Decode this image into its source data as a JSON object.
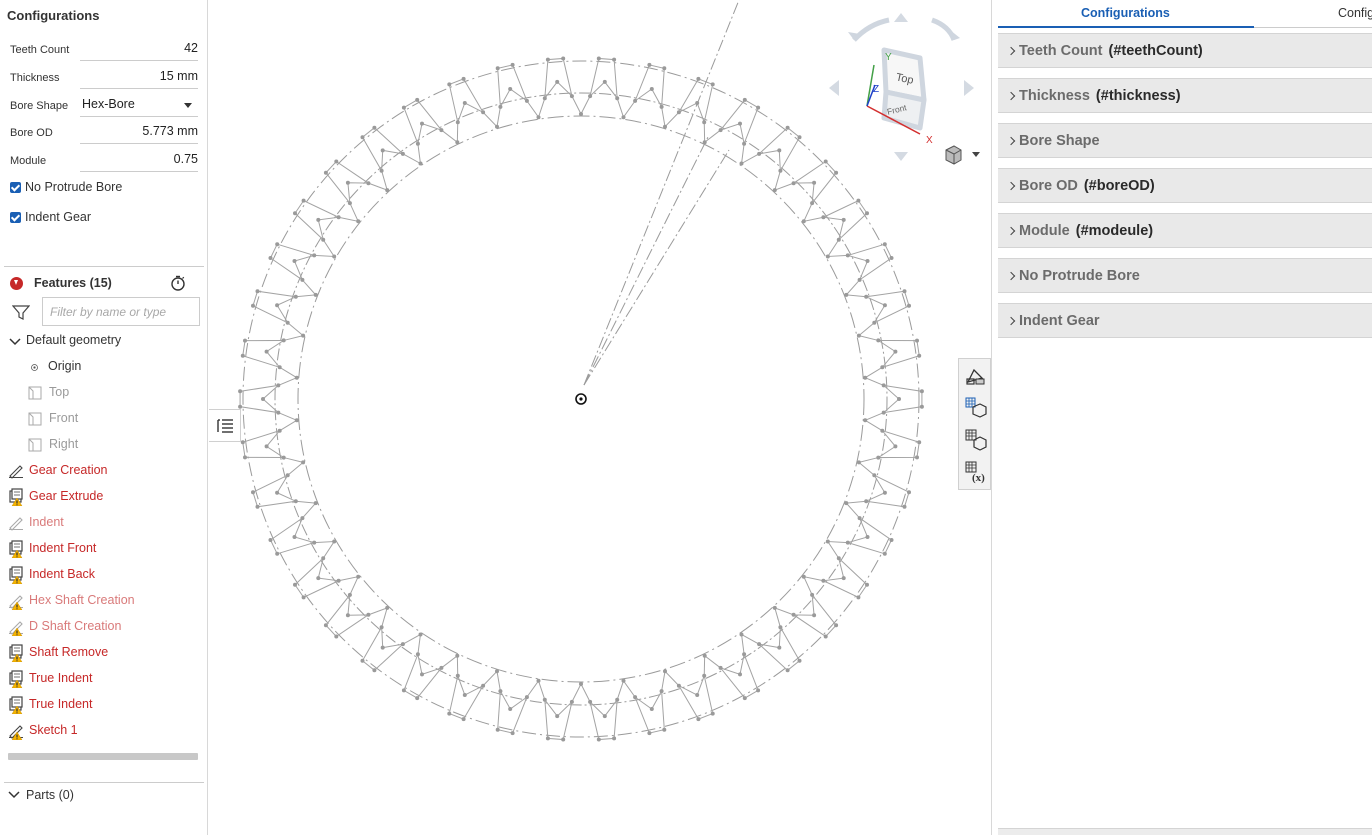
{
  "config_panel": {
    "title": "Configurations",
    "fields": [
      {
        "label": "Teeth Count",
        "value": "42"
      },
      {
        "label": "Thickness",
        "value": "15 mm"
      },
      {
        "label": "Bore Shape",
        "value": "Hex-Bore"
      },
      {
        "label": "Bore OD",
        "value": "5.773 mm"
      },
      {
        "label": "Module",
        "value": "0.75"
      }
    ],
    "checkboxes": [
      {
        "label": "No Protrude Bore",
        "checked": true
      },
      {
        "label": "Indent Gear",
        "checked": true
      }
    ]
  },
  "features": {
    "title": "Features (15)",
    "filter_placeholder": "Filter by name or type",
    "default_geometry": "Default geometry",
    "geometry_items": [
      "Origin",
      "Top",
      "Front",
      "Right"
    ],
    "items": [
      {
        "label": "Gear Creation",
        "icon": "sketch-icon",
        "warning": false,
        "state": "error"
      },
      {
        "label": "Gear Extrude",
        "icon": "extrude-icon",
        "warning": true,
        "state": "error"
      },
      {
        "label": "Indent",
        "icon": "sketch-icon",
        "warning": false,
        "state": "suppressed"
      },
      {
        "label": "Indent Front",
        "icon": "extrude-icon",
        "warning": true,
        "state": "error"
      },
      {
        "label": "Indent Back",
        "icon": "extrude-icon",
        "warning": true,
        "state": "error"
      },
      {
        "label": "Hex Shaft Creation",
        "icon": "sketch-icon",
        "warning": true,
        "state": "suppressed"
      },
      {
        "label": "D Shaft Creation",
        "icon": "sketch-icon",
        "warning": true,
        "state": "suppressed"
      },
      {
        "label": "Shaft Remove",
        "icon": "extrude-icon",
        "warning": true,
        "state": "error"
      },
      {
        "label": "True Indent",
        "icon": "extrude-icon",
        "warning": true,
        "state": "error"
      },
      {
        "label": "True Indent",
        "icon": "extrude-icon",
        "warning": true,
        "state": "error"
      },
      {
        "label": "Sketch 1",
        "icon": "sketch-icon",
        "warning": true,
        "state": "error"
      }
    ],
    "parts": "Parts (0)"
  },
  "view_cube": {
    "top": "Top",
    "front": "Front",
    "axis_x": "X",
    "axis_y": "Y",
    "axis_z": "Z"
  },
  "right_panel": {
    "tabs": [
      "Configurations",
      "Configu"
    ],
    "sections": [
      {
        "name": "Teeth Count",
        "id": "(#teethCount)"
      },
      {
        "name": "Thickness",
        "id": "(#thickness)"
      },
      {
        "name": "Bore Shape",
        "id": ""
      },
      {
        "name": "Bore OD",
        "id": "(#boreOD)"
      },
      {
        "name": "Module",
        "id": "(#modeule)"
      },
      {
        "name": "No Protrude Bore",
        "id": ""
      },
      {
        "name": "Indent Gear",
        "id": ""
      }
    ]
  },
  "colors": {
    "accent": "#1a5fb4",
    "error": "#c62828",
    "suppressed": "#d97a7a",
    "warning": "#f5b400"
  }
}
